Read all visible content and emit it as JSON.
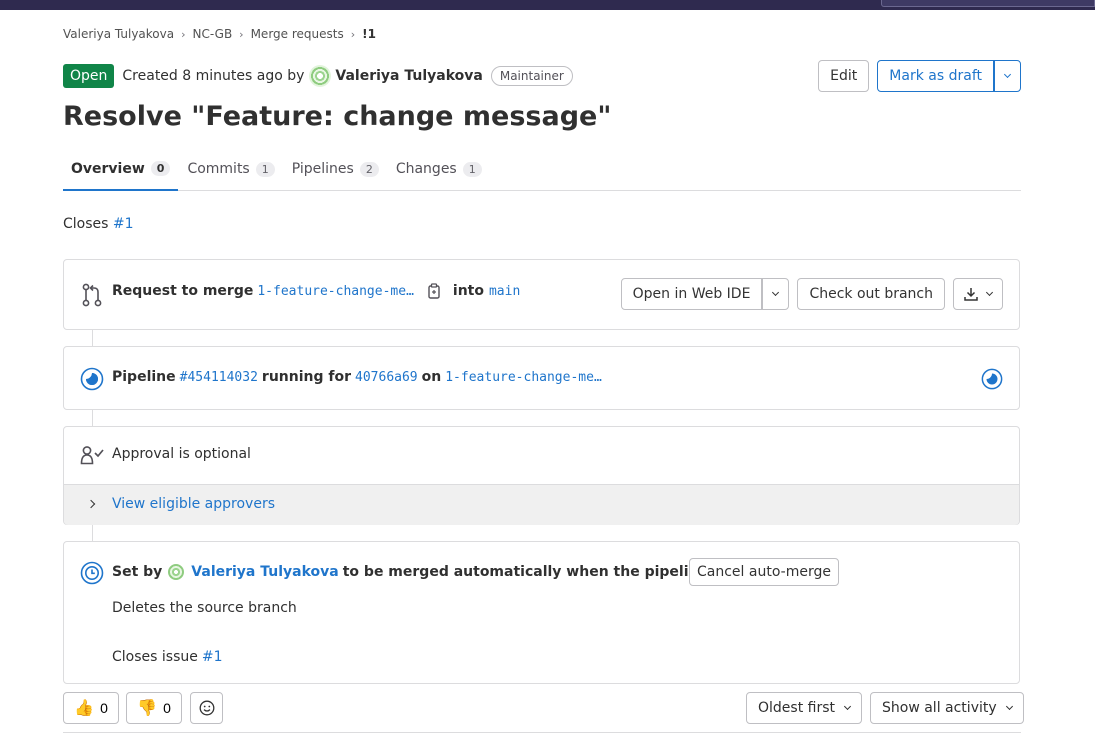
{
  "breadcrumb": [
    "Valeriya Tulyakova",
    "NC-GB",
    "Merge requests",
    "!1"
  ],
  "header": {
    "status": "Open",
    "created_text": "Created 8 minutes ago by",
    "author": "Valeriya Tulyakova",
    "role": "Maintainer",
    "edit_label": "Edit",
    "draft_label": "Mark as draft"
  },
  "title": "Resolve \"Feature: change message\"",
  "tabs": [
    {
      "label": "Overview",
      "count": "0"
    },
    {
      "label": "Commits",
      "count": "1"
    },
    {
      "label": "Pipelines",
      "count": "2"
    },
    {
      "label": "Changes",
      "count": "1"
    }
  ],
  "closes": {
    "text": "Closes",
    "issue": "#1"
  },
  "merge_request": {
    "prefix": "Request to merge",
    "source_branch": "1-feature-change-me…",
    "into": "into",
    "target_branch": "main",
    "web_ide_label": "Open in Web IDE",
    "checkout_label": "Check out branch"
  },
  "pipeline": {
    "label": "Pipeline",
    "id": "#454114032",
    "running_for": "running for",
    "commit": "40766a69",
    "on": "on",
    "branch": "1-feature-change-me…"
  },
  "approval": {
    "text": "Approval is optional",
    "link": "View eligible approvers"
  },
  "auto_merge": {
    "set_by": "Set by",
    "user": "Valeriya Tulyakova",
    "suffix": "to be merged automatically when the pipeline succeeds",
    "cancel_label": "Cancel auto-merge",
    "deletes": "Deletes the source branch",
    "closes_issue": "Closes issue",
    "issue": "#1"
  },
  "reactions": {
    "thumbsup": "0",
    "thumbsdown": "0"
  },
  "sort_label": "Oldest first",
  "filter_label": "Show all activity",
  "colors": {
    "accent": "#1f75cb",
    "open": "#108548",
    "topbar": "#2f2a4f"
  }
}
